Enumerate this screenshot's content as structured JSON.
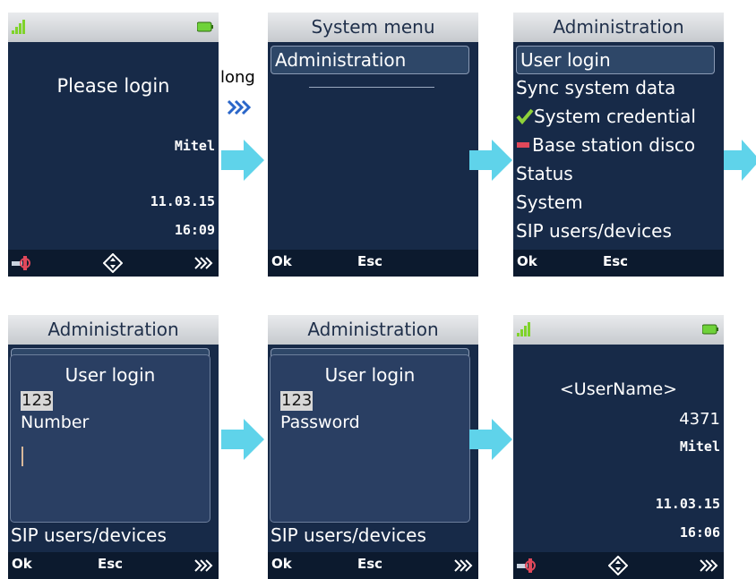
{
  "flow_label": "long",
  "screen1": {
    "message": "Please login",
    "brand": "Mitel",
    "date": "11.03.15",
    "time": "16:09"
  },
  "screen2": {
    "title": "System menu",
    "items": [
      "Administration"
    ],
    "softkeys": {
      "left": "Ok",
      "middle": "Esc"
    }
  },
  "screen3": {
    "title": "Administration",
    "items": [
      "User login",
      "Sync system data",
      "System credential",
      "Base station disco",
      "Status",
      "System",
      "SIP users/devices"
    ],
    "softkeys": {
      "left": "Ok",
      "middle": "Esc"
    }
  },
  "screen4": {
    "title": "Administration",
    "bg_items": [
      "User login",
      "SIP users/devices"
    ],
    "popup": {
      "title": "User login",
      "mode": "123",
      "field_label": "Number"
    },
    "softkeys": {
      "left": "Ok",
      "middle": "Esc"
    }
  },
  "screen5": {
    "title": "Administration",
    "bg_items": [
      "User login",
      "SIP users/devices"
    ],
    "popup": {
      "title": "User login",
      "mode": "123",
      "field_label": "Password"
    },
    "softkeys": {
      "left": "Ok",
      "middle": "Esc"
    }
  },
  "screen6": {
    "username": "<UserName>",
    "number": "4371",
    "brand": "Mitel",
    "date": "11.03.15",
    "time": "16:06"
  },
  "colors": {
    "screen_bg": "#172a48",
    "titlebar": "#d5d8dc",
    "arrow": "#5fd3ea",
    "battery": "#6fd23a",
    "signal": "#7fd32a"
  },
  "icons": [
    "signal-icon",
    "battery-icon",
    "keylock-icon",
    "navigation-icon",
    "forward-icon",
    "checkmark-icon",
    "minus-icon",
    "flow-arrow-icon"
  ]
}
